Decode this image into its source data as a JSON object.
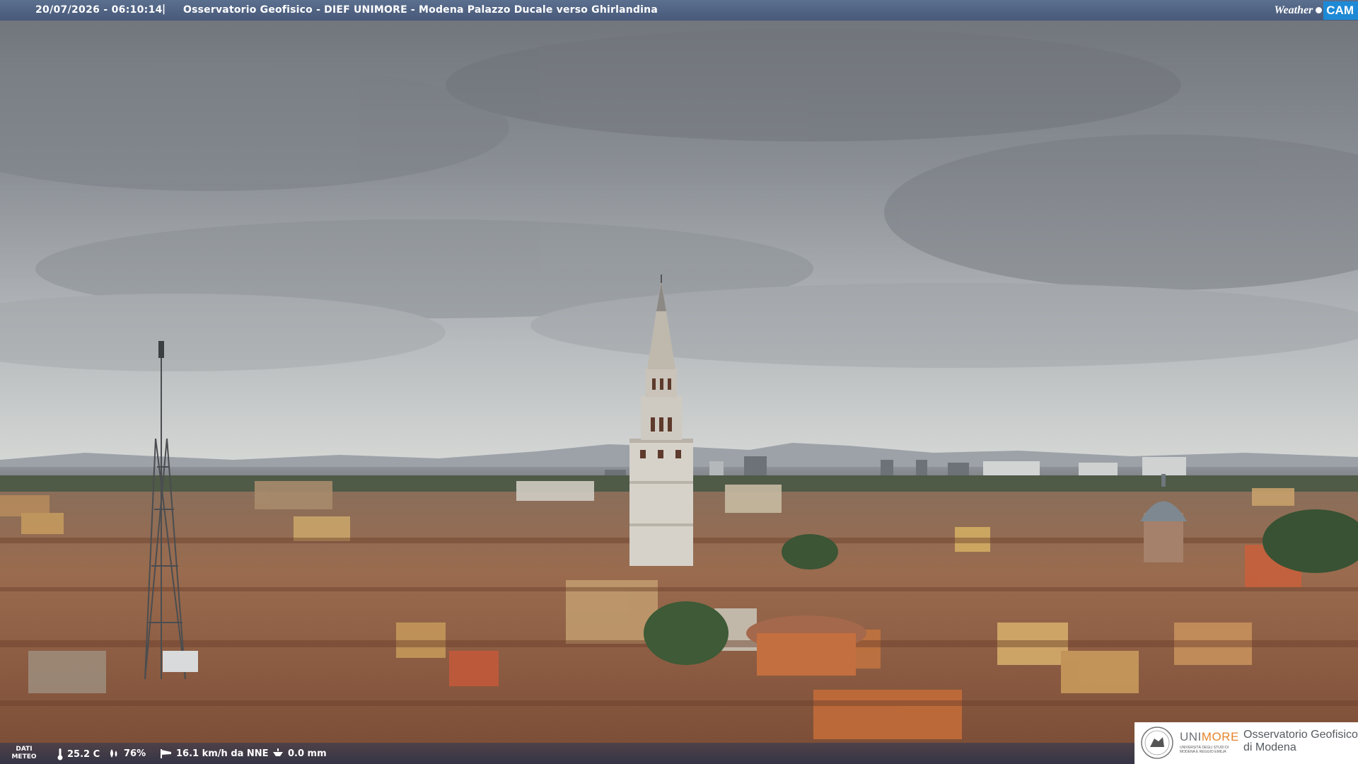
{
  "header": {
    "timestamp": "20/07/2026 - 06:10:14",
    "separator": "|",
    "title": "Osservatorio Geofisico - DIEF UNIMORE - Modena Palazzo Ducale verso Ghirlandina",
    "logo_weather": "Weather",
    "logo_cam": "CAM"
  },
  "weather": {
    "label_line1": "DATI",
    "label_line2": "METEO",
    "temperature": "25.2 C",
    "humidity": "76%",
    "wind": "16.1 km/h da NNE",
    "rain": "0.0 mm"
  },
  "branding": {
    "uni_name_a": "UNI",
    "uni_name_b": "MORE",
    "uni_sub": "UNIVERSITÀ DEGLI STUDI DI MODENA E REGGIO EMILIA",
    "observatory_line1": "Osservatorio Geofisico",
    "observatory_line2": "di Modena"
  },
  "colors": {
    "header_bg": "#4f6384",
    "logo_blue": "#1e8ad6",
    "unimore_orange": "#e5842f"
  },
  "icons": {
    "temperature": "thermometer-icon",
    "humidity": "droplets-icon",
    "wind": "wind-sock-icon",
    "rain": "rain-gauge-icon"
  }
}
